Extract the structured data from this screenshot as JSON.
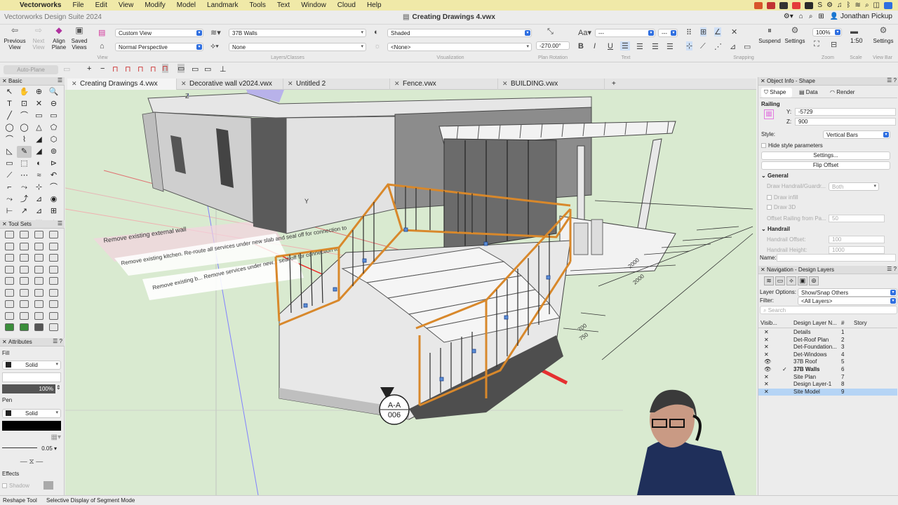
{
  "menubar": {
    "app_name": "Vectorworks",
    "items": [
      "File",
      "Edit",
      "View",
      "Modify",
      "Model",
      "Landmark",
      "Tools",
      "Text",
      "Window",
      "Cloud",
      "Help"
    ],
    "icon_colors": [
      "#d8552b",
      "#c13333",
      "#333333",
      "#e43b3b",
      "#2a2a2a",
      "#2f6fe0",
      "#333333"
    ]
  },
  "titlebar": {
    "app_title": "Vectorworks Design Suite 2024",
    "doc_title": "Creating Drawings 4.vwx",
    "user": "Jonathan Pickup"
  },
  "toolbar": {
    "previous_view": "Previous\nView",
    "next_view": "Next\nView",
    "align_plane": "Align\nPlane",
    "saved_views": "Saved\nViews",
    "view_group": "View",
    "view_dropdown": "Custom View",
    "projection_dropdown": "Normal Perspective",
    "layer_dropdown": "37B Walls",
    "class_dropdown": "None",
    "layers_classes_group": "Layers/Classes",
    "render_dropdown": "Shaded",
    "lighting_dropdown": "<None>",
    "visualization_group": "Visualization",
    "plan_rotation_value": "-270.00°",
    "plan_rotation_group": "Plan Rotation",
    "text_style_dropdown": "---",
    "text_size_dropdown": "---",
    "text_group": "Text",
    "snapping_group": "Snapping",
    "suspend": "Suspend",
    "settings": "Settings",
    "zoom_value": "100%",
    "zoom_group": "Zoom",
    "scale_value": "1:50",
    "scale_group": "Scale",
    "viewbar_settings": "Settings",
    "view_bar_group": "View Bar"
  },
  "modebar": {
    "auto_plane": "Auto-Plane"
  },
  "tabs": [
    {
      "label": "Creating Drawings 4.vwx"
    },
    {
      "label": "Decorative wall v2024.vwx"
    },
    {
      "label": "Untitled 2"
    },
    {
      "label": "Fence.vwx"
    },
    {
      "label": "BUILDING.vwx"
    }
  ],
  "leftpanel": {
    "basic_title": "Basic",
    "toolsets_title": "Tool Sets",
    "attributes_title": "Attributes",
    "fill_label": "Fill",
    "fill_style": "Solid",
    "fill_opacity": "100%",
    "pen_label": "Pen",
    "pen_style": "Solid",
    "line_weight": "0.05",
    "effects_label": "Effects",
    "shadow_label": "Shadow",
    "basic_tools": [
      "↖",
      "✋",
      "⊕",
      "🔍",
      "T",
      "⊡",
      "✕",
      "⊖",
      "╱",
      "⌒",
      "▭",
      "▭",
      "◯",
      "◯",
      "△",
      "⬠",
      "⌒",
      "⌇",
      "◢",
      "⬡",
      "◺",
      "✎",
      "◢",
      "⊚",
      "▭",
      "⬚",
      "◐",
      "⊳",
      "⟋",
      "⋯",
      "≈",
      "↶",
      "⌐",
      "⤳",
      "⊹",
      "⌒",
      "⤳",
      "⤴",
      "⊿",
      "◉",
      "⊢",
      "↗",
      "⊿",
      "⊞",
      "⊖",
      "▭",
      "⬚",
      "✧"
    ],
    "toolset_rows": 9
  },
  "attributes_colors": {
    "fill": "#ffffff",
    "pen": "#000000",
    "opacity_bar": "#555555"
  },
  "drawing": {
    "annot1": "Remove existing external wall",
    "annot2": "Remove existing kitchen. Re-route all services under new slab and seal off for connection to",
    "annot3": "Remove existing b... Remove services under new... seal off for connection to",
    "section_marker_top": "A-A",
    "section_marker_bottom": "006",
    "axis_z": "Z",
    "axis_y": "Y",
    "dim_values": [
      "2000",
      "2000",
      "700",
      "750"
    ]
  },
  "objinfo": {
    "title": "Object Info - Shape",
    "tab_shape": "Shape",
    "tab_data": "Data",
    "tab_render": "Render",
    "object_type": "Railing",
    "y_label": "Y:",
    "y_value": "-5729",
    "z_label": "Z:",
    "z_value": "900",
    "style_label": "Style:",
    "style_value": "Vertical Bars",
    "hide_style": "Hide style parameters",
    "settings_btn": "Settings...",
    "flip_offset_btn": "Flip Offset",
    "general_header": "General",
    "draw_handrail": "Draw Handrail/Guardr...",
    "draw_handrail_value": "Both",
    "draw_infill": "Draw infill",
    "draw_3d": "Draw 3D",
    "offset_railing": "Offset Railing from Pa...",
    "offset_railing_value": "50",
    "handrail_header": "Handrail",
    "handrail_offset": "Handrail Offset:",
    "handrail_offset_value": "100",
    "handrail_height": "Handrail Height:",
    "handrail_height_value": "1000",
    "name_label": "Name:"
  },
  "navigation": {
    "title": "Navigation - Design Layers",
    "layer_options_label": "Layer Options:",
    "layer_options_value": "Show/Snap Others",
    "filter_label": "Filter:",
    "filter_value": "<All Layers>",
    "search_placeholder": "Search",
    "col_visibility": "Visib...",
    "col_name": "Design Layer N...",
    "col_num": "#",
    "col_story": "Story",
    "layers": [
      {
        "vis": "✕",
        "check": "",
        "name": "Details",
        "num": "1",
        "bold": false,
        "selected": false
      },
      {
        "vis": "✕",
        "check": "",
        "name": "Det-Roof Plan",
        "num": "2",
        "bold": false,
        "selected": false
      },
      {
        "vis": "✕",
        "check": "",
        "name": "Det-Foundation...",
        "num": "3",
        "bold": false,
        "selected": false
      },
      {
        "vis": "✕",
        "check": "",
        "name": "Det-Windows",
        "num": "4",
        "bold": false,
        "selected": false
      },
      {
        "vis": "👁",
        "check": "",
        "name": "37B Roof",
        "num": "5",
        "bold": false,
        "selected": false
      },
      {
        "vis": "👁",
        "check": "✓",
        "name": "37B Walls",
        "num": "6",
        "bold": true,
        "selected": false
      },
      {
        "vis": "✕",
        "check": "",
        "name": "Site Plan",
        "num": "7",
        "bold": false,
        "selected": false
      },
      {
        "vis": "✕",
        "check": "",
        "name": "Design Layer-1",
        "num": "8",
        "bold": false,
        "selected": false
      },
      {
        "vis": "✕",
        "check": "",
        "name": "Site Model",
        "num": "9",
        "bold": false,
        "selected": true
      }
    ]
  },
  "status": {
    "tool": "Reshape Tool",
    "mode": "Selective Display of Segment Mode"
  }
}
